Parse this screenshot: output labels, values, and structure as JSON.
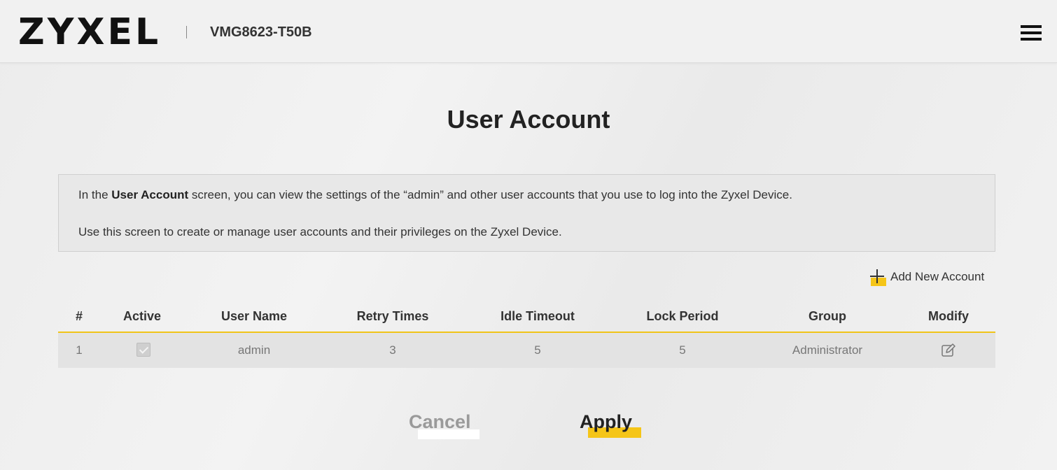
{
  "header": {
    "logo": "ZYXEL",
    "model": "VMG8623-T50B"
  },
  "page": {
    "title": "User Account"
  },
  "info": {
    "line1_prefix": "In the ",
    "line1_bold": "User Account",
    "line1_suffix": " screen, you can view the settings of the “admin” and other user accounts that you use to log into the Zyxel Device.",
    "line2": "Use this screen to create or manage user accounts and their privileges on the Zyxel Device."
  },
  "actions": {
    "add_account": "Add New Account"
  },
  "table": {
    "columns": [
      "#",
      "Active",
      "User Name",
      "Retry Times",
      "Idle Timeout",
      "Lock Period",
      "Group",
      "Modify"
    ],
    "rows": [
      {
        "index": "1",
        "active": true,
        "user_name": "admin",
        "retry_times": "3",
        "idle_timeout": "5",
        "lock_period": "5",
        "group": "Administrator"
      }
    ]
  },
  "buttons": {
    "cancel": "Cancel",
    "apply": "Apply"
  },
  "colors": {
    "accent": "#f5c518",
    "header_bg": "#f1f1f1",
    "row_bg": "#e3e3e3"
  },
  "icons": {
    "menu": "hamburger-menu-icon",
    "add": "plus-icon",
    "modify": "edit-icon",
    "active": "checkbox-checked-icon"
  }
}
